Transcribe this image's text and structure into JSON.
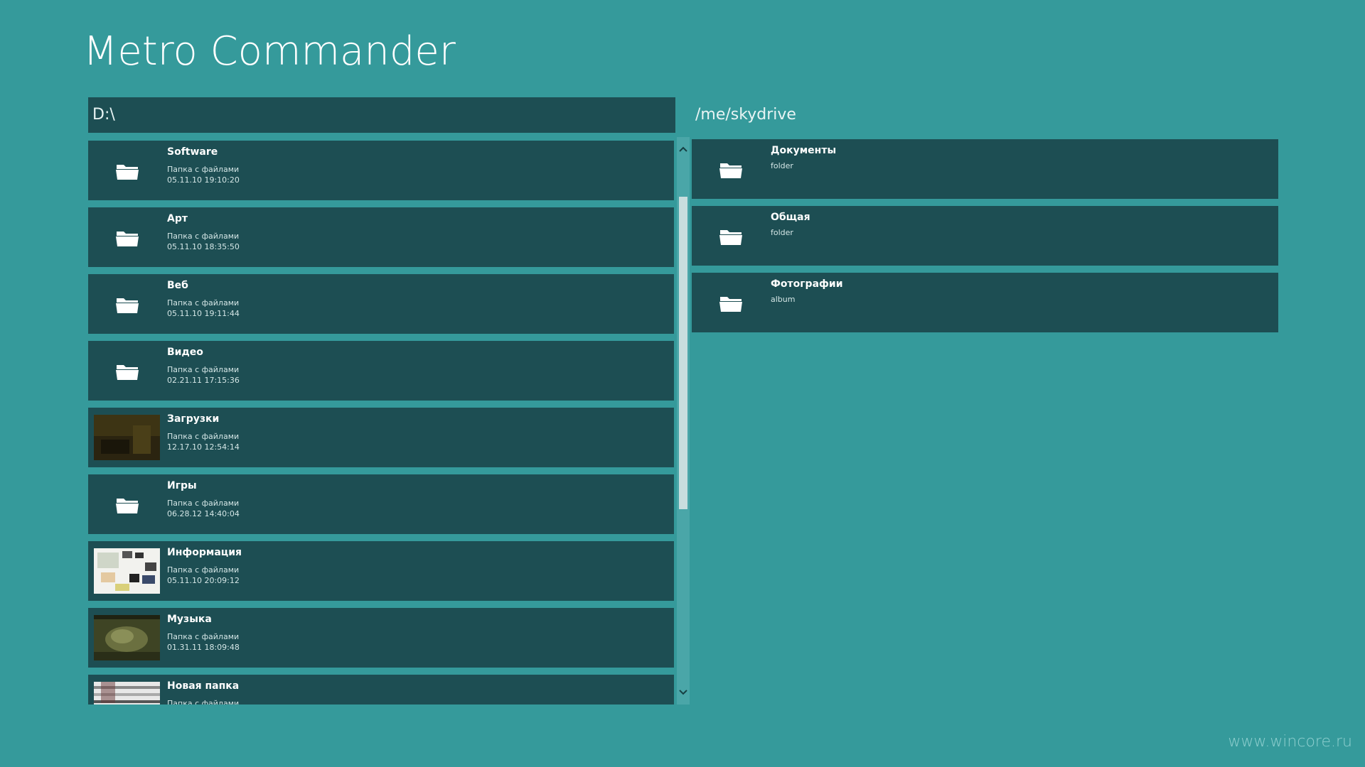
{
  "app": {
    "title": "Metro Commander"
  },
  "left_panel": {
    "path": "D:\\",
    "items": [
      {
        "name": "Software",
        "type": "Папка с файлами",
        "date": "05.11.10 19:10:20",
        "thumb": "folder"
      },
      {
        "name": "Арт",
        "type": "Папка с файлами",
        "date": "05.11.10 18:35:50",
        "thumb": "folder"
      },
      {
        "name": "Веб",
        "type": "Папка с файлами",
        "date": "05.11.10 19:11:44",
        "thumb": "folder"
      },
      {
        "name": "Видео",
        "type": "Папка с файлами",
        "date": "02.21.11 17:15:36",
        "thumb": "folder"
      },
      {
        "name": "Загрузки",
        "type": "Папка с файлами",
        "date": "12.17.10 12:54:14",
        "thumb": "photo-dark"
      },
      {
        "name": "Игры",
        "type": "Папка с файлами",
        "date": "06.28.12 14:40:04",
        "thumb": "folder"
      },
      {
        "name": "Информация",
        "type": "Папка с файлами",
        "date": "05.11.10 20:09:12",
        "thumb": "photo-collage"
      },
      {
        "name": "Музыка",
        "type": "Папка с файлами",
        "date": "01.31.11 18:09:48",
        "thumb": "photo-dragon"
      },
      {
        "name": "Новая папка",
        "type": "Папка с файлами",
        "date": "",
        "thumb": "photo-stripes"
      }
    ]
  },
  "right_panel": {
    "path": "/me/skydrive",
    "items": [
      {
        "name": "Документы",
        "type": "folder"
      },
      {
        "name": "Общая",
        "type": "folder"
      },
      {
        "name": "Фотографии",
        "type": "album"
      }
    ]
  },
  "scrollbar": {
    "up_icon": "chevron-up-icon",
    "down_icon": "chevron-down-icon",
    "position": 0.12
  },
  "watermark": "www.wincore.ru",
  "colors": {
    "background": "#359a9b",
    "row": "#1d4e53",
    "text": "#ffffff"
  }
}
